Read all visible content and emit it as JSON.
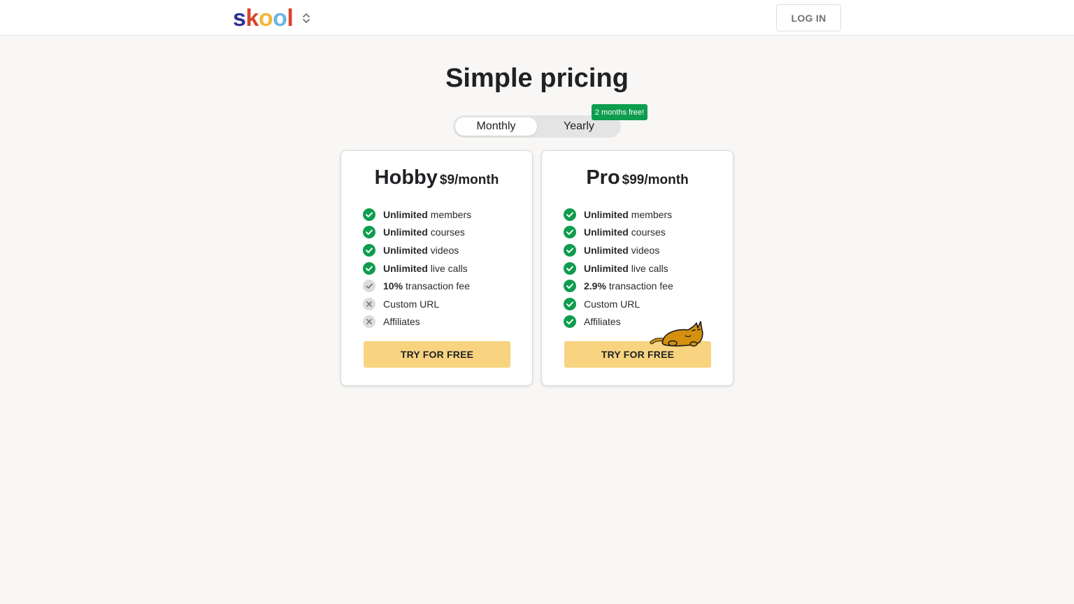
{
  "brand": {
    "letters": [
      "s",
      "k",
      "o",
      "o",
      "l"
    ],
    "letter_colors": [
      "#2e3192",
      "#d9442b",
      "#f4b63b",
      "#6cb4e4",
      "#d9442b"
    ]
  },
  "header": {
    "switcher_icon": "chevron-up-down-icon",
    "login_label": "LOG IN"
  },
  "page": {
    "title": "Simple pricing"
  },
  "billing": {
    "options": [
      "Monthly",
      "Yearly"
    ],
    "selected": "Monthly",
    "promo": "2 months free!"
  },
  "plans": [
    {
      "name": "Hobby",
      "price": "$9/month",
      "features": [
        {
          "bold": "Unlimited",
          "text": "members",
          "status": "included"
        },
        {
          "bold": "Unlimited",
          "text": "courses",
          "status": "included"
        },
        {
          "bold": "Unlimited",
          "text": "videos",
          "status": "included"
        },
        {
          "bold": "Unlimited",
          "text": "live calls",
          "status": "included"
        },
        {
          "bold": "10%",
          "text": "transaction fee",
          "status": "partial"
        },
        {
          "bold": "",
          "text": "Custom URL",
          "status": "excluded"
        },
        {
          "bold": "",
          "text": "Affiliates",
          "status": "excluded"
        }
      ],
      "cta": "TRY FOR FREE"
    },
    {
      "name": "Pro",
      "price": "$99/month",
      "features": [
        {
          "bold": "Unlimited",
          "text": "members",
          "status": "included"
        },
        {
          "bold": "Unlimited",
          "text": "courses",
          "status": "included"
        },
        {
          "bold": "Unlimited",
          "text": "videos",
          "status": "included"
        },
        {
          "bold": "Unlimited",
          "text": "live calls",
          "status": "included"
        },
        {
          "bold": "2.9%",
          "text": "transaction fee",
          "status": "included"
        },
        {
          "bold": "",
          "text": "Custom URL",
          "status": "included"
        },
        {
          "bold": "",
          "text": "Affiliates",
          "status": "included"
        }
      ],
      "cta": "TRY FOR FREE"
    }
  ],
  "colors": {
    "check_green": "#0e9d4e",
    "cta_yellow": "#f8d481",
    "muted_gray": "#dcdcdc"
  },
  "decorations": {
    "mascot_icon": "cat-mascot-icon"
  }
}
